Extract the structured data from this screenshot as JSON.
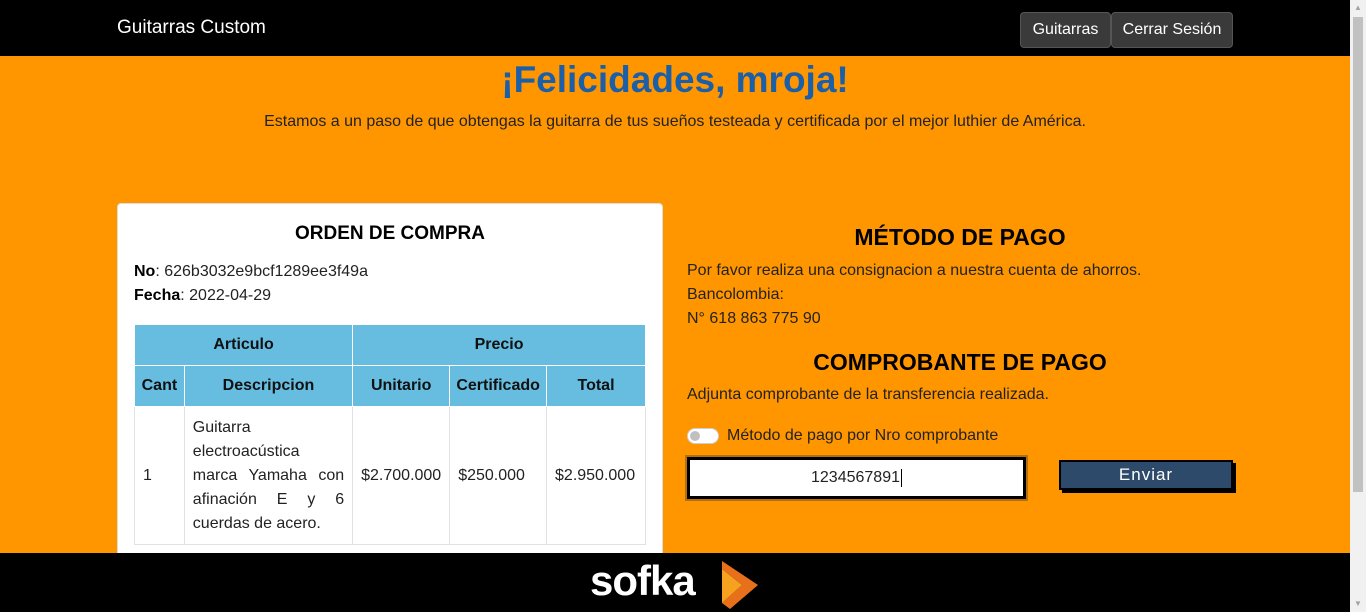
{
  "navbar": {
    "brand": "Guitarras Custom",
    "buttons": [
      "Guitarras",
      "Cerrar Sesión"
    ]
  },
  "hero": {
    "title": "¡Felicidades, mroja!",
    "subtitle": "Estamos a un paso de que obtengas la guitarra de tus sueños testeada y certificada por el mejor luthier de América."
  },
  "order": {
    "title": "ORDEN DE COMPRA",
    "number_label": "No",
    "number_value": "626b3032e9bcf1289ee3f49a",
    "date_label": "Fecha",
    "date_value": "2022-04-29",
    "group_headers": [
      "Articulo",
      "Precio"
    ],
    "columns": [
      "Cant",
      "Descripcion",
      "Unitario",
      "Certificado",
      "Total"
    ],
    "rows": [
      {
        "cant": "1",
        "descripcion": "Guitarra electroacústica marca Yamaha con afinación E y 6 cuerdas de acero.",
        "unitario": "$2.700.000",
        "certificado": "$250.000",
        "total": "$2.950.000"
      }
    ]
  },
  "payment": {
    "title": "MÉTODO DE PAGO",
    "lines": [
      "Por favor realiza una consignacion a nuestra cuenta de ahorros.",
      "Bancolombia:",
      "N° 618 863 775 90"
    ]
  },
  "voucher": {
    "title": "COMPROBANTE DE PAGO",
    "instructions": "Adjunta comprobante de la transferencia realizada.",
    "toggle_label": "Método de pago por Nro comprobante",
    "toggle_on": false,
    "input_value": "1234567891",
    "submit_label": "Enviar"
  },
  "footer": {
    "logo_text": "sofka"
  },
  "colors": {
    "background": "#ff9600",
    "title": "#1b5fa8",
    "table_header": "#66bde0",
    "send_button": "#2e4a6b"
  }
}
